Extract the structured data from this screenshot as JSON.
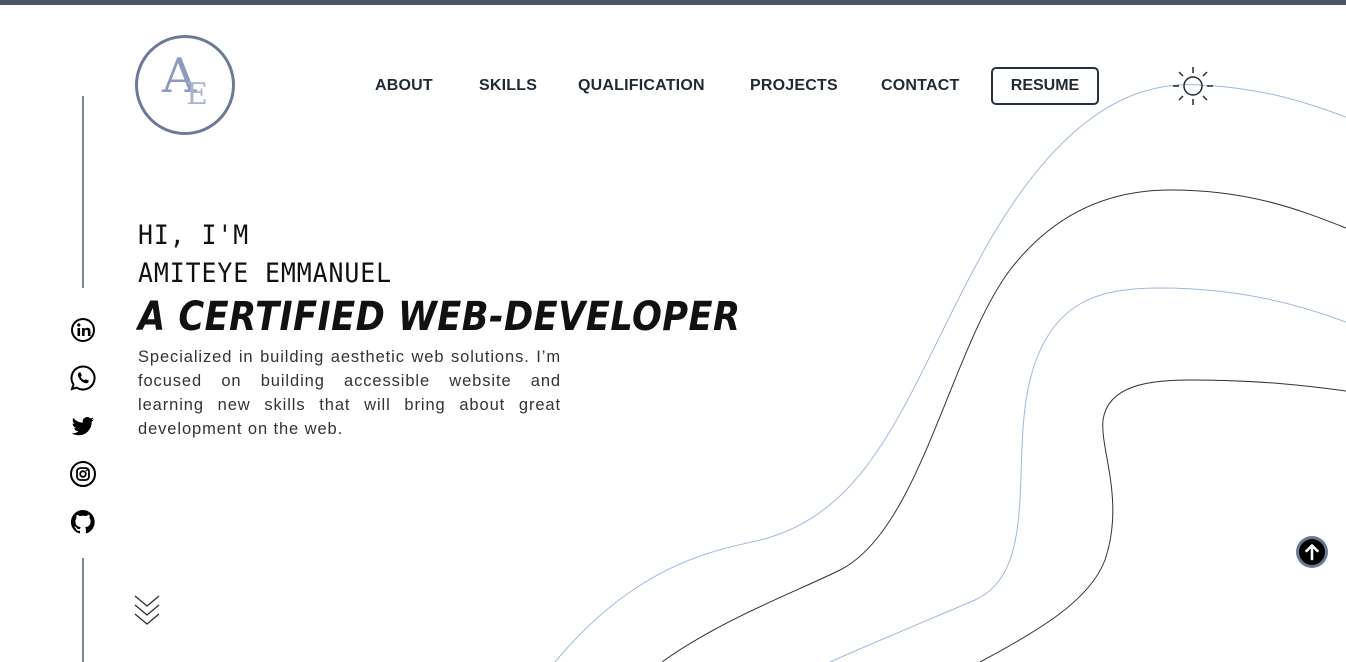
{
  "logo": {
    "letter_a": "A",
    "letter_e": "E"
  },
  "nav": {
    "items": [
      {
        "label": "ABOUT"
      },
      {
        "label": "SKILLS"
      },
      {
        "label": "QUALIFICATION"
      },
      {
        "label": "PROJECTS"
      },
      {
        "label": "CONTACT"
      }
    ],
    "resume_label": "RESUME"
  },
  "hero": {
    "greeting": "HI, I'M",
    "name": "AMITEYE EMMANUEL",
    "title": "A CERTIFIED WEB-DEVELOPER",
    "description": "Specialized in building aesthetic web solutions. I’m focused on building accessible website and learning new skills that will bring about great development on the web."
  },
  "socials": [
    {
      "icon": "linkedin-icon"
    },
    {
      "icon": "whatsapp-icon"
    },
    {
      "icon": "twitter-icon"
    },
    {
      "icon": "instagram-icon"
    },
    {
      "icon": "github-icon"
    }
  ],
  "icons": {
    "theme_toggle": "sun-icon",
    "scroll_down": "chevrons-down-icon",
    "back_to_top": "arrow-up-icon"
  },
  "colors": {
    "top_bar": "#4a5663",
    "logo_ring": "#6c7a97",
    "wave_blue": "#9fb8e0",
    "wave_dark": "#333333",
    "text": "#1f2933"
  }
}
